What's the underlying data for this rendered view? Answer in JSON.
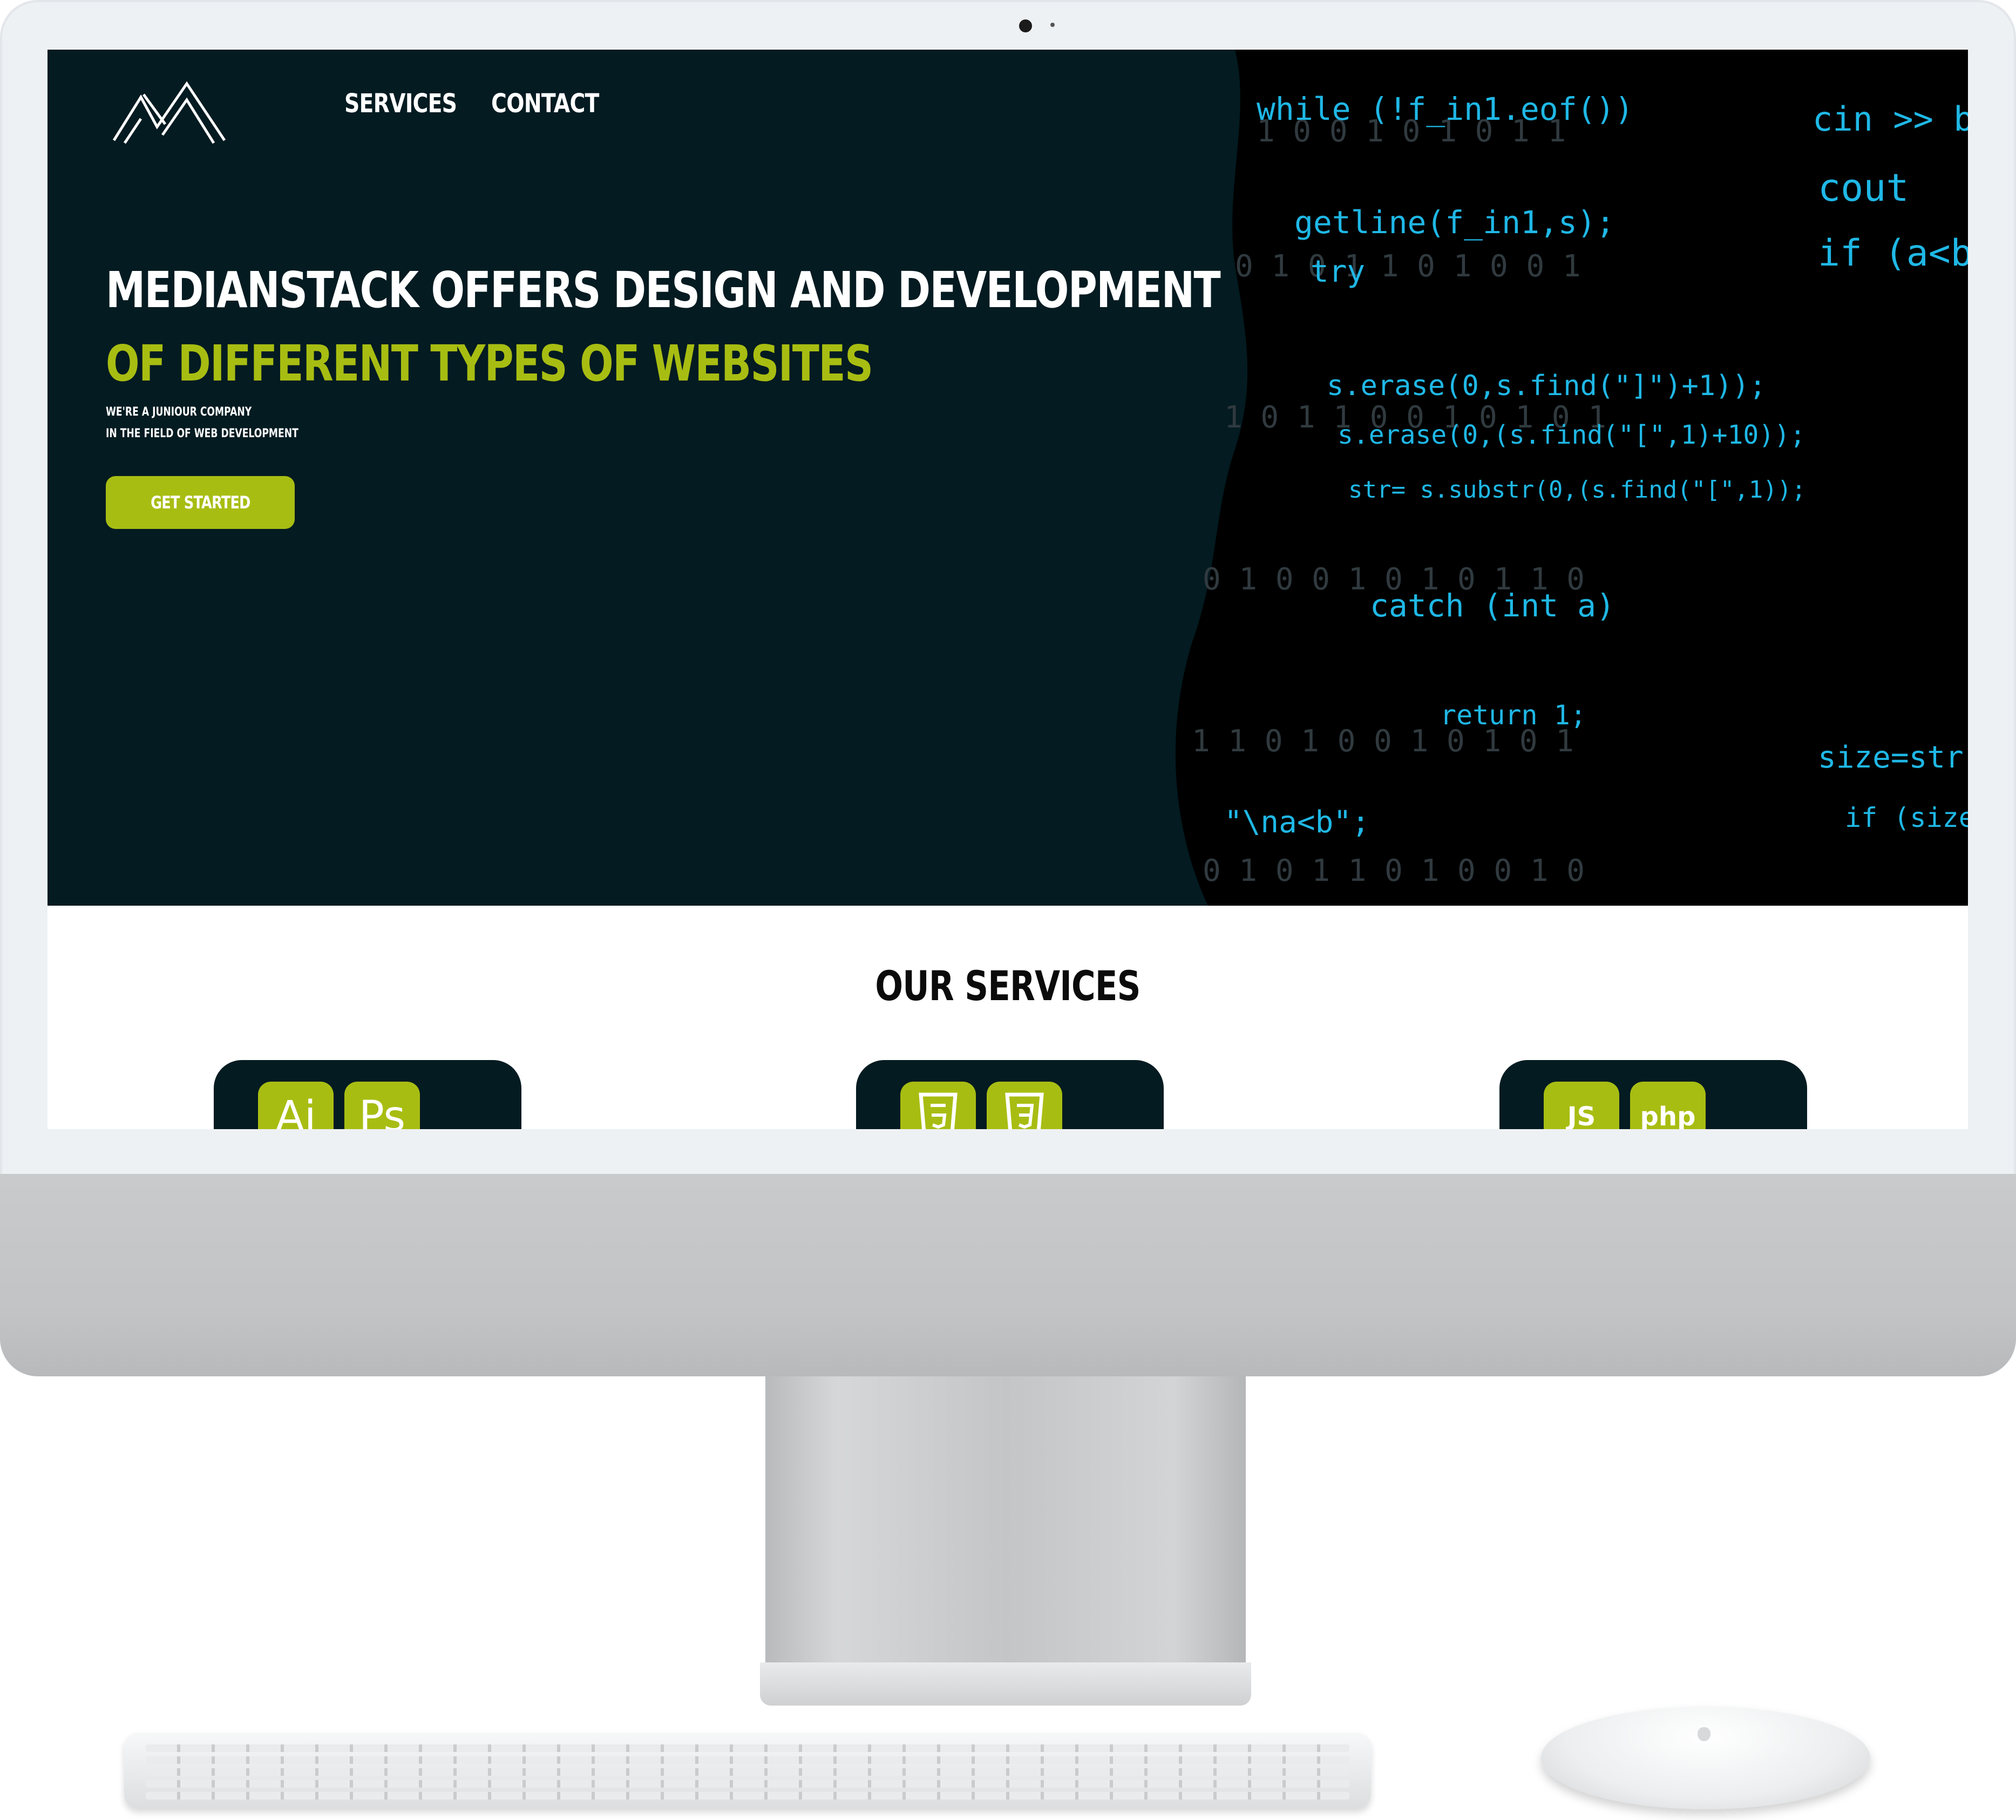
{
  "nav": {
    "items": [
      "SERVICES",
      "CONTACT"
    ]
  },
  "hero": {
    "headline_line1": "MEDIANSTACK OFFERS DESIGN AND DEVELOPMENT",
    "headline_line2": "OF DIFFERENT TYPES OF WEBSITES",
    "subtext_line1": "WE'RE A JUNIOUR COMPANY",
    "subtext_line2": "IN THE FIELD OF WEB DEVELOPMENT",
    "cta_label": "GET STARTED"
  },
  "services": {
    "title": "OUR SERVICES",
    "cards": [
      {
        "icons": [
          "Ai",
          "Ps"
        ]
      },
      {
        "icons": [
          "html5-icon",
          "css3-icon"
        ]
      },
      {
        "icons": [
          "JS",
          "php"
        ]
      }
    ]
  },
  "code_background": {
    "lines": [
      "while (!f_in1.eof())",
      "getline(f_in1,s);",
      "try",
      "s.erase(0,s.find(\"]\")+1));",
      "s.erase(0,(s.find(\"[\",1)+10));",
      "str= s.substr(0,(s.find(\"[\",1));",
      "catch (int a)",
      "return 1;",
      "cin >> b",
      "cout",
      "if (a<b",
      "size=str.com",
      "if (size",
      "\"\\na<b\";"
    ]
  },
  "colors": {
    "hero_bg": "#031b21",
    "accent": "#a8bd12",
    "code_cyan": "#1fb8e6"
  }
}
